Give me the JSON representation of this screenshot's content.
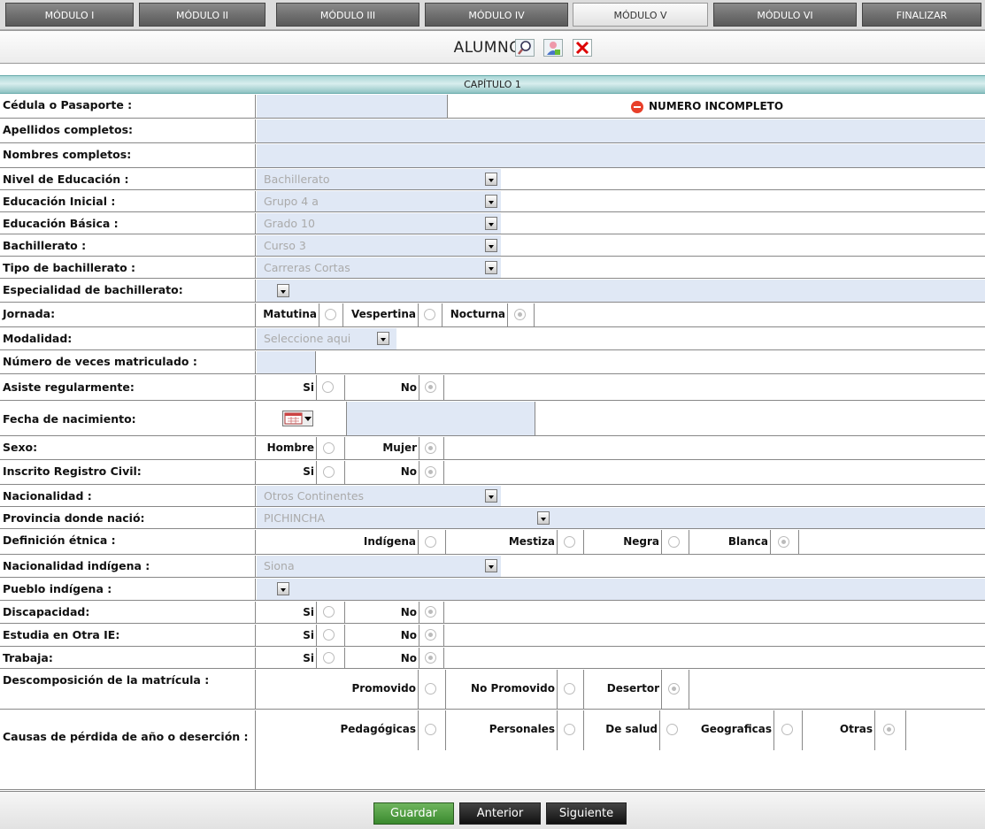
{
  "tabs": [
    "MÓDULO I",
    "MÓDULO II",
    "MÓDULO III",
    "MÓDULO IV",
    "MÓDULO V",
    "MÓDULO VI",
    "FINALIZAR"
  ],
  "active_tab": "MÓDULO V",
  "header": {
    "title": "ALUMNOS"
  },
  "chapter": "CAPÍTULO 1",
  "fields": {
    "cedula": {
      "label": "Cédula o Pasaporte :",
      "warning": "NUMERO INCOMPLETO"
    },
    "apellidos": {
      "label": "Apellidos completos:"
    },
    "nombres": {
      "label": "Nombres completos:"
    },
    "nivel": {
      "label": "Nivel de Educación :",
      "value": "Bachillerato"
    },
    "inicial": {
      "label": "Educación Inicial :",
      "value": "Grupo 4 a"
    },
    "basica": {
      "label": "Educación Básica :",
      "value": "Grado 10"
    },
    "bachillerato": {
      "label": "Bachillerato :",
      "value": "Curso 3"
    },
    "tipo_bach": {
      "label": "Tipo de bachillerato :",
      "value": "Carreras Cortas"
    },
    "especialidad": {
      "label": "Especialidad de bachillerato:"
    },
    "jornada": {
      "label": "Jornada:",
      "options": [
        "Matutina",
        "Vespertina",
        "Nocturna"
      ],
      "selected": "Nocturna"
    },
    "modalidad": {
      "label": "Modalidad:",
      "value": "Seleccione aqui"
    },
    "veces": {
      "label": "Número de veces matriculado :"
    },
    "asiste": {
      "label": "Asiste regularmente:",
      "options": [
        "Si",
        "No"
      ],
      "selected": "No"
    },
    "fecha": {
      "label": "Fecha de nacimiento:"
    },
    "sexo": {
      "label": "Sexo:",
      "options": [
        "Hombre",
        "Mujer"
      ],
      "selected": "Mujer"
    },
    "registro": {
      "label": "Inscrito Registro Civil:",
      "options": [
        "Si",
        "No"
      ],
      "selected": "No"
    },
    "nacionalidad": {
      "label": "Nacionalidad :",
      "value": "Otros Continentes"
    },
    "provincia": {
      "label": "Provincia donde nació:",
      "value": "PICHINCHA"
    },
    "etnica": {
      "label": "Definición étnica :",
      "options": [
        "Indígena",
        "Mestiza",
        "Negra",
        "Blanca"
      ],
      "selected": "Blanca"
    },
    "nac_indigena": {
      "label": "Nacionalidad indígena   :",
      "value": "Siona"
    },
    "pueblo": {
      "label": "Pueblo indígena :"
    },
    "discapacidad": {
      "label": "Discapacidad:",
      "options": [
        "Si",
        "No"
      ],
      "selected": "No"
    },
    "otra_ie": {
      "label": "Estudia en Otra IE:",
      "options": [
        "Si",
        "No"
      ],
      "selected": "No"
    },
    "trabaja": {
      "label": "Trabaja:",
      "options": [
        "Si",
        "No"
      ],
      "selected": "No"
    },
    "descomp": {
      "label": "Descomposición de la matrícula :",
      "options": [
        "Promovido",
        "No Promovido",
        "Desertor"
      ],
      "selected": "Desertor"
    },
    "causas": {
      "label": "Causas de pérdida de año o deserción :",
      "options": [
        "Pedagógicas",
        "Personales",
        "De salud",
        "Geograficas",
        "Otras"
      ],
      "selected": "Otras"
    }
  },
  "buttons": {
    "guardar": "Guardar",
    "anterior": "Anterior",
    "siguiente": "Siguiente"
  },
  "colors": {
    "guardar": "#3a8a2e",
    "nav": "#1a1a1a",
    "field_fill": "#e0e8f5",
    "header_teal": "#a9d6d6",
    "warning": "#e8402a"
  }
}
